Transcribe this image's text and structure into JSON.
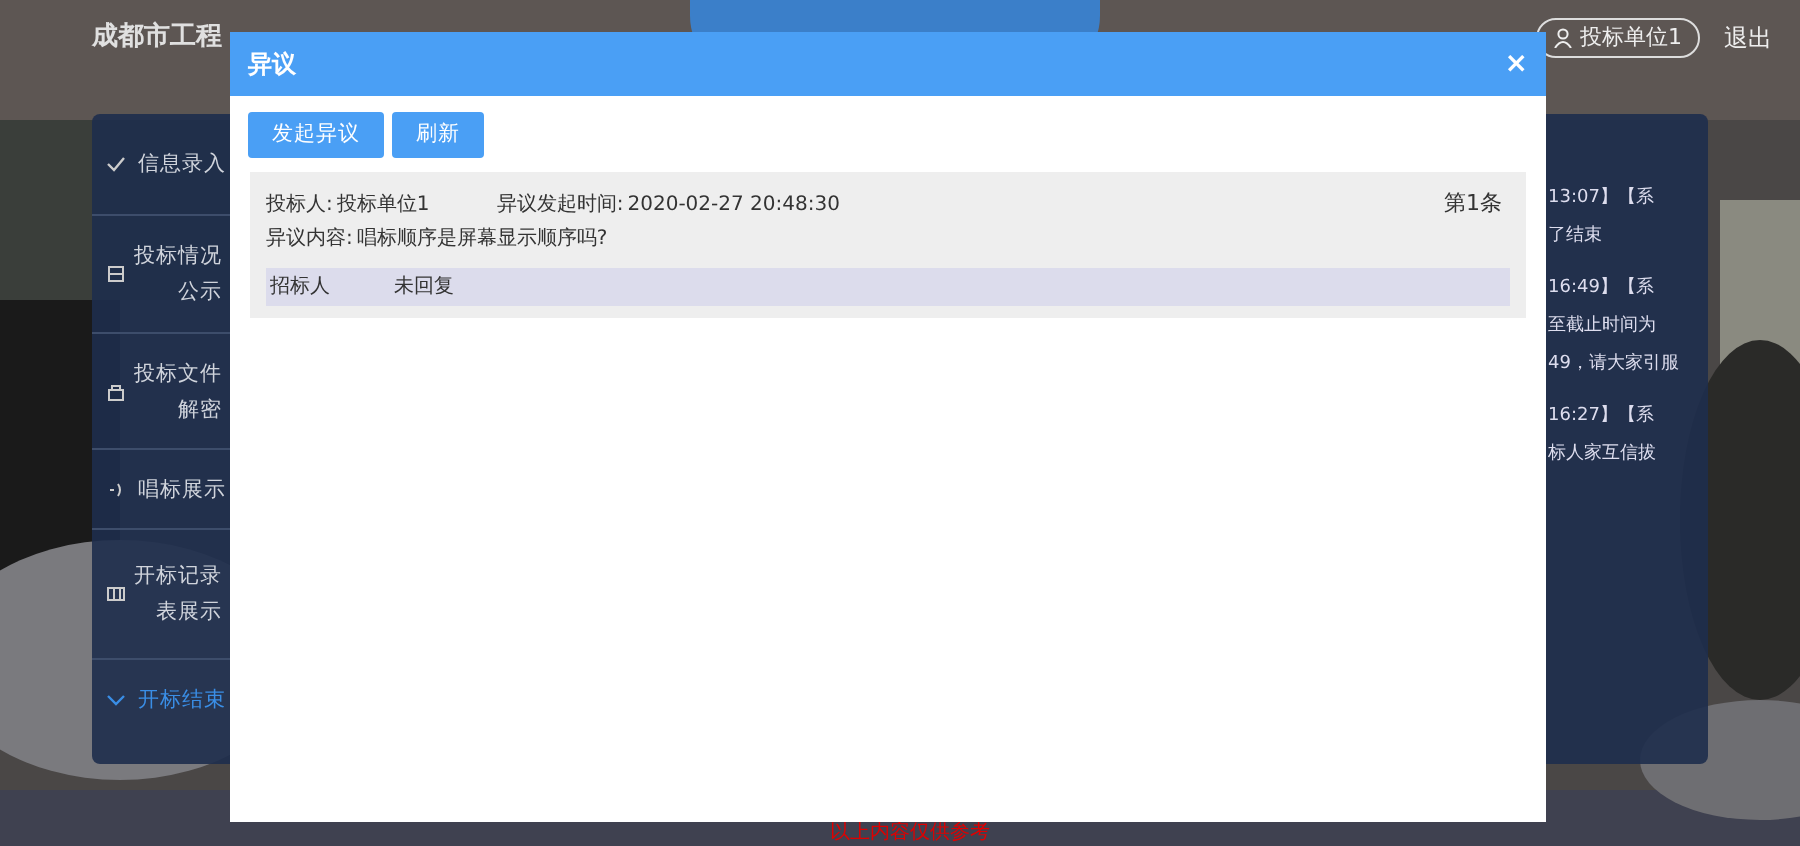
{
  "header": {
    "title": "成都市工程",
    "user": "投标单位1",
    "logout": "退出"
  },
  "sidebar": {
    "items": [
      {
        "kind": "check",
        "lines": [
          "信息录入"
        ],
        "selected": false
      },
      {
        "kind": "doc",
        "lines": [
          "投标情况",
          "公示"
        ],
        "selected": false
      },
      {
        "kind": "lock",
        "lines": [
          "投标文件",
          "解密"
        ],
        "selected": false
      },
      {
        "kind": "sound",
        "lines": [
          "唱标展示"
        ],
        "selected": false
      },
      {
        "kind": "table",
        "lines": [
          "开标记录",
          "表展示"
        ],
        "selected": false
      },
      {
        "kind": "chevron",
        "lines": [
          "开标结束"
        ],
        "selected": true
      }
    ]
  },
  "messages": [
    {
      "lines": [
        "13:07】【系",
        "了结束"
      ]
    },
    {
      "lines": [
        "16:49】【系",
        "至截止时间为",
        "49，请大家引服"
      ]
    },
    {
      "lines": [
        "16:27】【系",
        "标人家互信拔"
      ]
    }
  ],
  "footer_note": "以上内容仅供参考",
  "dialog": {
    "title": "异议",
    "close": "×",
    "buttons": [
      "发起异议",
      "刷新"
    ],
    "objections": [
      {
        "bidder_label": "投标人:",
        "bidder": "投标单位1",
        "time_label": "异议发起时间:",
        "time": "2020-02-27 20:48:30",
        "index": "第1条",
        "content_label": "异议内容:",
        "content": "唱标顺序是屏幕显示顺序吗?",
        "replies": [
          {
            "from": "招标人",
            "status": "未回复"
          }
        ]
      }
    ]
  }
}
